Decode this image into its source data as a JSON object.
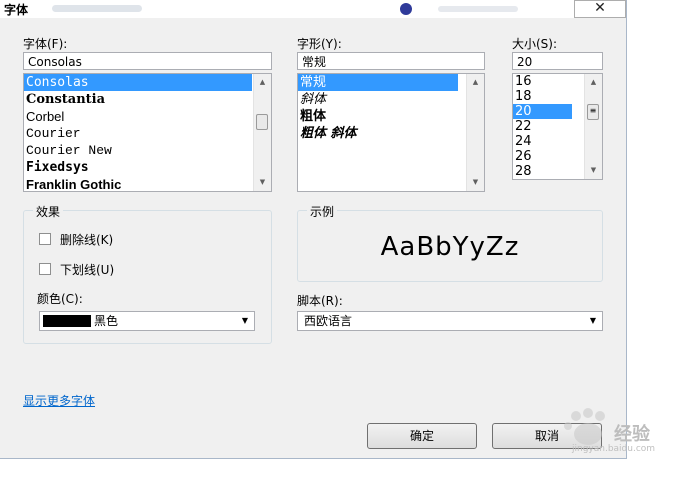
{
  "window": {
    "title": "字体",
    "close_glyph": "✕"
  },
  "font": {
    "label": "字体(F):",
    "value": "Consolas",
    "items": [
      "Consolas",
      "Constantia",
      "Corbel",
      "Courier",
      "Courier New",
      "Fixedsys",
      "Franklin Gothic"
    ]
  },
  "style": {
    "label": "字形(Y):",
    "value": "常规",
    "items": [
      "常规",
      "斜体",
      "粗体",
      "粗体 斜体"
    ]
  },
  "size": {
    "label": "大小(S):",
    "value": "20",
    "items": [
      "16",
      "18",
      "20",
      "22",
      "24",
      "26",
      "28"
    ]
  },
  "effects": {
    "label": "效果",
    "strikethrough": "删除线(K)",
    "underline": "下划线(U)",
    "color_label": "颜色(C):",
    "color_value": "黑色",
    "color_swatch": "#000000"
  },
  "sample": {
    "label": "示例",
    "text": "AaBbYyZz"
  },
  "script": {
    "label": "脚本(R):",
    "value": "西欧语言"
  },
  "more_fonts_link": "显示更多字体",
  "buttons": {
    "ok": "确定",
    "cancel": "取消"
  },
  "watermark": {
    "text": "经验",
    "sub": "jingyan.baidu.com"
  },
  "colors": {
    "selection": "#3399ff",
    "link": "#0066cc"
  }
}
